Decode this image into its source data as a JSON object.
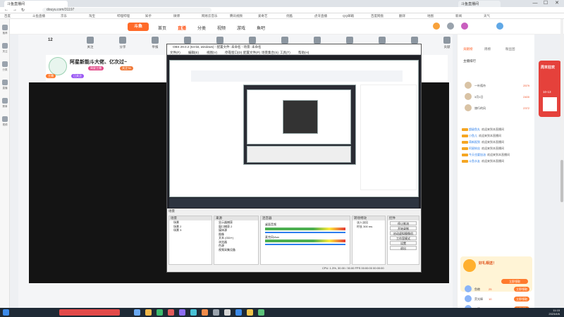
{
  "browser": {
    "tab_active": "斗鱼直播间",
    "tab_title_right": "斗鱼直播间",
    "url": "douyu.com/31197",
    "win_min": "—",
    "win_max": "☐",
    "win_close": "✕",
    "bookmarks": [
      "百度",
      "斗鱼直播",
      "京东",
      "淘宝",
      "哔哩哔哩",
      "知乎",
      "微博",
      "网易云音乐",
      "腾讯视频",
      "爱奇艺",
      "优酷",
      "虎牙直播",
      "QQ邮箱",
      "百度网盘",
      "翻译",
      "地图",
      "新闻",
      "天气"
    ]
  },
  "left_sidebar": [
    "推荐",
    "关注",
    "分类",
    "直播",
    "赛事",
    "视频"
  ],
  "site": {
    "logo": "斗鱼",
    "nav": [
      {
        "label": "首页",
        "active": false
      },
      {
        "label": "直播",
        "active": true
      },
      {
        "label": "分类",
        "active": false
      },
      {
        "label": "视频",
        "active": false
      },
      {
        "label": "游戏",
        "active": false
      },
      {
        "label": "鱼吧",
        "active": false
      }
    ]
  },
  "toolrow": {
    "count": "12",
    "items": [
      "关注",
      "分享",
      "举报",
      "弹幕设置",
      "全屏",
      "画质",
      "模式",
      "录屏",
      "截图",
      "任务",
      "背包",
      "贡献"
    ],
    "pc_btn": "PC客户端"
  },
  "room": {
    "title": "阿星新能斗大佬、亿次过~",
    "tags": [
      "主播",
      "已关注",
      "周星主播",
      "关注TA"
    ],
    "follow_btn": "关注"
  },
  "obs": {
    "title": "OBS 29.0.2 (64-bit, windows) - 配置文件: 未命名 - 场景: 未命名",
    "menu": [
      "文件(F)",
      "编辑(E)",
      "视图(V)",
      "停靠窗口(D)",
      "配置文件(P)",
      "场景集合(S)",
      "工具(T)",
      "帮助(H)"
    ],
    "docks": {
      "scenes": {
        "title": "场景",
        "items": [
          "场景",
          "场景 2",
          "场景 3"
        ]
      },
      "sources": {
        "title": "来源",
        "items": [
          "显示器捕获",
          "窗口捕获 2",
          "媒体源",
          "图像",
          "文本 (GDI+)",
          "浏览器",
          "色源",
          "视频采集设备"
        ]
      },
      "mixer": {
        "title": "混音器",
        "items": [
          "桌面音频",
          "麦克风/Aux"
        ]
      },
      "transitions": {
        "title": "转场特效",
        "items": [
          "淡入淡出",
          "时长 300 ms"
        ]
      },
      "controls": {
        "title": "控件",
        "buttons": [
          "停止推流",
          "开始录制",
          "启动虚拟摄像机",
          "工作室模式",
          "设置",
          "退出"
        ]
      }
    },
    "statusbar": "CPU: 1.3%, 30.00 / 30.00 FPS   00:00:00   00:00:00"
  },
  "right_panel": {
    "rank_title": "主播排行",
    "rank_tabs": [
      "贡献榜",
      "周榜",
      "粉丝团"
    ],
    "ranks": [
      {
        "name": "一叶孤舟",
        "value": "2579"
      },
      {
        "name": "3月1日",
        "value": "2400"
      },
      {
        "name": "旅行的风",
        "value": "2372"
      }
    ],
    "chat": [
      {
        "name": "超级鱼丸",
        "text": "欢迎来到本直播间"
      },
      {
        "name": "小鱼儿",
        "text": "欢迎来到本直播间"
      },
      {
        "name": "萌新报到",
        "text": "欢迎来到本直播间"
      },
      {
        "name": "阿星粉丝",
        "text": "欢迎来到本直播间"
      },
      {
        "name": "今天也要加油",
        "text": "欢迎来到本直播间"
      },
      {
        "name": "斗鱼水友",
        "text": "欢迎来到本直播间"
      }
    ],
    "gift_btn": "立即领取",
    "promo": "好礼相送！",
    "bottom_items": [
      {
        "name": "鱼粮",
        "value": "25",
        "btn": "立即领取"
      },
      {
        "name": "荧光棒",
        "value": "10",
        "btn": "立即领取"
      },
      {
        "name": "火箭",
        "value": "2",
        "btn": "立即领取"
      }
    ]
  },
  "float_ad": {
    "title": "周末狂欢",
    "subtitle": "10-13"
  },
  "taskbar": {
    "time": "11:15",
    "date": "2023/4/6"
  },
  "colors": {
    "brand": "#ff5d23",
    "accent_orange": "#ff7a2d",
    "player_bg": "#141414",
    "taskbar": "#1f2a36"
  }
}
